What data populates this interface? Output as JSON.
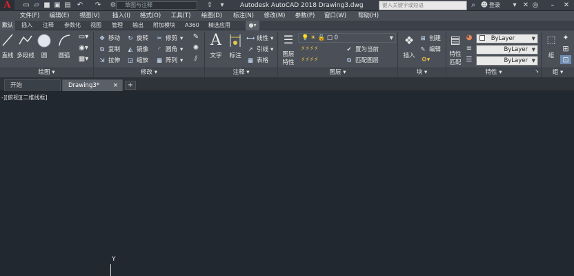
{
  "titlebar": {
    "app_letter": "A",
    "workspace": "草图与注释",
    "doc_title": "Autodesk AutoCAD 2018    Drawing3.dwg",
    "search_placeholder": "键入关键字或短语",
    "login": "登录"
  },
  "menus": [
    "文件(F)",
    "编辑(E)",
    "视图(V)",
    "插入(I)",
    "格式(O)",
    "工具(T)",
    "绘图(D)",
    "标注(N)",
    "修改(M)",
    "参数(P)",
    "窗口(W)",
    "帮助(H)"
  ],
  "ribbon_tabs": [
    "默认",
    "插入",
    "注释",
    "参数化",
    "视图",
    "管理",
    "输出",
    "附加模块",
    "A360",
    "精选应用"
  ],
  "ribbon": {
    "draw": {
      "line": "直线",
      "polyline": "多段线",
      "circle": "圆",
      "arc": "圆弧",
      "panel": "绘图 ▾"
    },
    "modify": {
      "move": "移动",
      "rotate": "旋转",
      "trim": "修剪",
      "copy": "复制",
      "mirror": "镜像",
      "fillet": "圆角",
      "stretch": "拉伸",
      "scale": "缩放",
      "array": "阵列",
      "panel": "修改 ▾"
    },
    "annotation": {
      "text": "文字",
      "dimension": "标注",
      "linear": "线性",
      "leader": "引线",
      "table": "表格",
      "panel": "注释 ▾"
    },
    "layers": {
      "layer_props_1": "图层",
      "layer_props_2": "特性",
      "current_layer": "0",
      "make_current": "置为当前",
      "match_layer": "匹配图层",
      "panel": "图层 ▾"
    },
    "block": {
      "insert": "插入",
      "create": "创建",
      "edit": "编辑",
      "panel": "块 ▾"
    },
    "properties": {
      "match_1": "特性",
      "match_2": "匹配",
      "color": "ByLayer",
      "linetype": "ByLayer",
      "lineweight": "ByLayer",
      "panel": "特性 ▾"
    },
    "groups": {
      "group": "组",
      "panel": "组 ▾"
    }
  },
  "file_tabs": {
    "start": "开始",
    "drawing": "Drawing3*",
    "close": "×",
    "add": "+"
  },
  "canvas": {
    "viewport_label": "-][俯视][二维线框]",
    "ucs_y": "Y"
  },
  "colors": {
    "accent": "#e01f26",
    "canvas": "#212830",
    "ribbon": "#4b5058"
  }
}
